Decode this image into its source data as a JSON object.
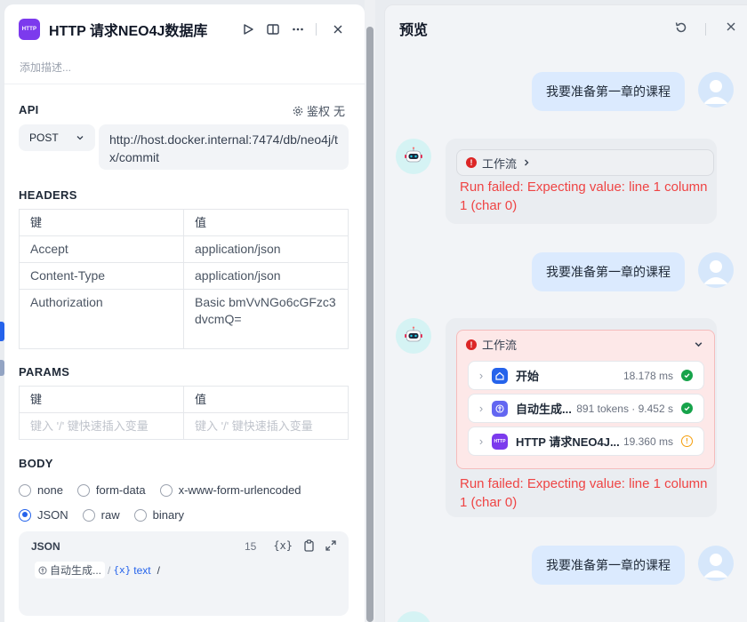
{
  "node": {
    "icon_text": "HTTP",
    "title": "HTTP 请求NEO4J数据库",
    "description_placeholder": "添加描述..."
  },
  "api": {
    "label": "API",
    "auth_label": "鉴权",
    "auth_value": "无",
    "method": "POST",
    "url": "http://host.docker.internal:7474/db/neo4j/tx/commit"
  },
  "headers": {
    "label": "HEADERS",
    "col_key": "键",
    "col_value": "值",
    "rows": [
      {
        "key": "Accept",
        "value": "application/json"
      },
      {
        "key": "Content-Type",
        "value": "application/json"
      },
      {
        "key": "Authorization",
        "value": "Basic bmVvNGo6cGFzc3dvcmQ="
      }
    ]
  },
  "params": {
    "label": "PARAMS",
    "col_key": "键",
    "col_value": "值",
    "key_placeholder": "键入 '/' 键快速插入变量",
    "value_placeholder": "键入 '/' 键快速插入变量"
  },
  "body": {
    "label": "BODY",
    "options": [
      "none",
      "form-data",
      "x-www-form-urlencoded",
      "JSON",
      "raw",
      "binary"
    ],
    "selected": "JSON",
    "json_label": "JSON",
    "json_count": "15",
    "var_node": "自动生成...",
    "var_sep": "/",
    "var_name": "text",
    "var_tail": "/"
  },
  "preview": {
    "title": "预览",
    "messages": [
      {
        "role": "user",
        "text": "我要准备第一章的课程"
      },
      {
        "role": "bot",
        "workflow_label": "工作流",
        "error": "Run failed: Expecting value: line 1 column 1 (char 0)"
      },
      {
        "role": "user",
        "text": "我要准备第一章的课程"
      },
      {
        "role": "bot",
        "workflow_label": "工作流",
        "error": "Run failed: Expecting value: line 1 column 1 (char 0)",
        "nodes": [
          {
            "name": "开始",
            "meta": "18.178 ms",
            "status": "success"
          },
          {
            "name": "自动生成...",
            "meta": "891 tokens · 9.452 s",
            "status": "success"
          },
          {
            "name": "HTTP 请求NEO4J...",
            "meta": "19.360 ms",
            "status": "failed"
          }
        ]
      },
      {
        "role": "user",
        "text": "我要准备第一章的课程"
      }
    ]
  },
  "colors": {
    "accent": "#2563eb",
    "error": "#ef4444",
    "success": "#16a34a",
    "warning": "#f59e0b"
  }
}
